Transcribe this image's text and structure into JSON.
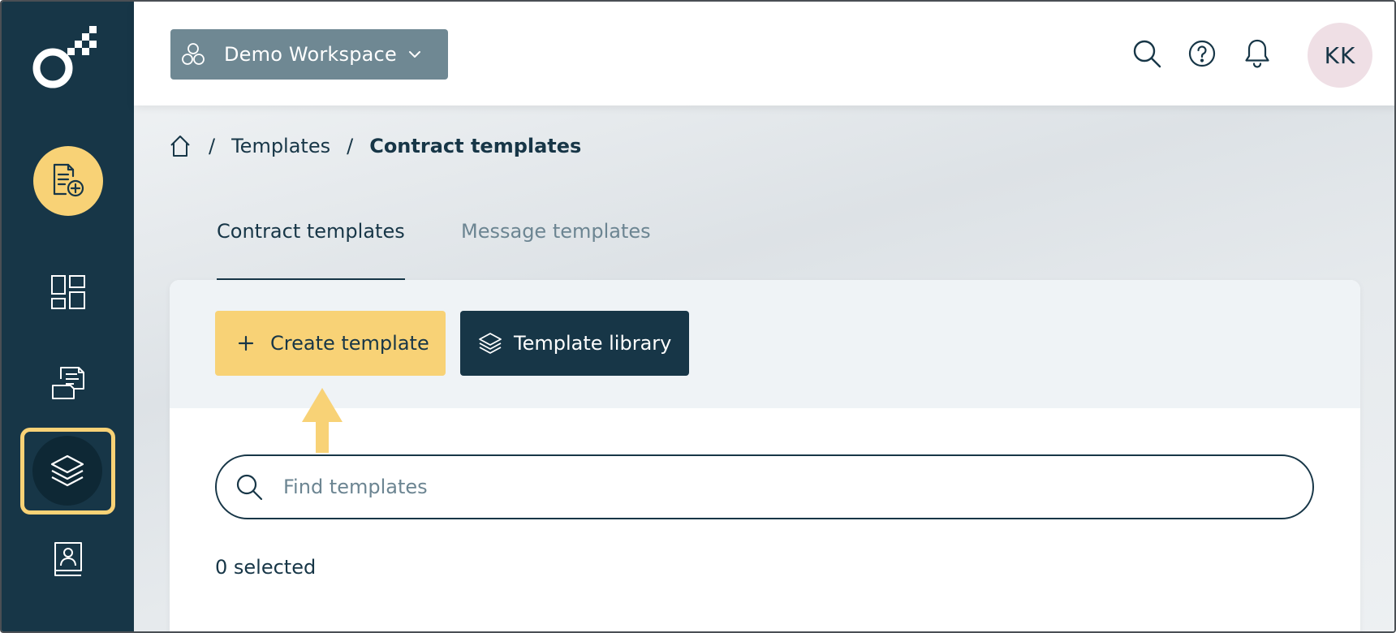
{
  "sidebar": {
    "logo": "app-logo",
    "new_document_icon": "new-document-icon",
    "items": [
      {
        "name": "dashboard",
        "icon": "dashboard-icon"
      },
      {
        "name": "documents",
        "icon": "documents-icon"
      },
      {
        "name": "templates",
        "icon": "layers-icon",
        "active": true
      },
      {
        "name": "contacts",
        "icon": "contact-book-icon"
      }
    ],
    "colors": {
      "background": "#173647",
      "accent": "#f8d276"
    }
  },
  "header": {
    "workspace": {
      "label": "Demo Workspace",
      "icon": "workspace-icon",
      "chevron": "chevron-down-icon"
    },
    "icons": [
      "search-icon",
      "help-icon",
      "bell-icon"
    ],
    "avatar_initials": "KK"
  },
  "breadcrumb": {
    "home_icon": "home-icon",
    "separator": "/",
    "items": [
      "Templates",
      "Contract templates"
    ]
  },
  "tabs": [
    {
      "label": "Contract templates",
      "active": true
    },
    {
      "label": "Message templates",
      "active": false
    }
  ],
  "toolbar": {
    "create_label": "Create template",
    "library_label": "Template library"
  },
  "search": {
    "placeholder": "Find templates",
    "value": ""
  },
  "selection": {
    "count_text": "0 selected"
  }
}
